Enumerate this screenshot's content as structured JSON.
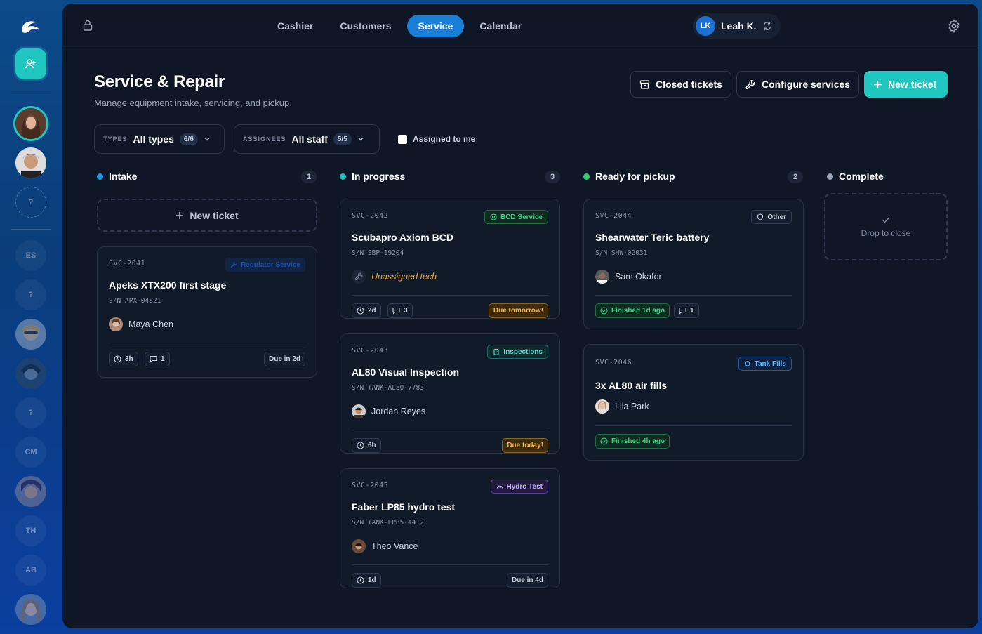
{
  "nav": {
    "tabs": [
      {
        "label": "Cashier"
      },
      {
        "label": "Customers"
      },
      {
        "label": "Service"
      },
      {
        "label": "Calendar"
      }
    ],
    "user": {
      "initials": "LK",
      "name": "Leah K."
    }
  },
  "rail": {
    "initials": [
      "?",
      "ES",
      "?",
      "?",
      "CM",
      "TH",
      "AB"
    ]
  },
  "page": {
    "title": "Service & Repair",
    "subtitle": "Manage equipment intake, servicing, and pickup."
  },
  "actions": {
    "closed": "Closed tickets",
    "configure": "Configure services",
    "new": "New ticket"
  },
  "filters": {
    "types": {
      "key": "TYPES",
      "value": "All types",
      "count": "6/6"
    },
    "assignees": {
      "key": "ASSIGNEES",
      "value": "All staff",
      "count": "5/5"
    },
    "assigned_to_me": "Assigned to me"
  },
  "columns": {
    "intake": {
      "title": "Intake",
      "count": "1",
      "add_label": "New ticket"
    },
    "progress": {
      "title": "In progress",
      "count": "3"
    },
    "ready": {
      "title": "Ready for pickup",
      "count": "2"
    },
    "complete": {
      "title": "Complete",
      "drop_label": "Drop to close"
    }
  },
  "tickets": {
    "t2041": {
      "code": "SVC-2041",
      "tag": "Regulator Service",
      "title": "Apeks XTX200 first stage",
      "sn": "S/N APX-04821",
      "tech": "Maya Chen",
      "time": "3h",
      "comments": "1",
      "due": "Due in 2d"
    },
    "t2042": {
      "code": "SVC-2042",
      "tag": "BCD Service",
      "title": "Scubapro Axiom BCD",
      "sn": "S/N SBP-19204",
      "tech": "Unassigned tech",
      "time": "2d",
      "comments": "3",
      "due": "Due tomorrow!"
    },
    "t2043": {
      "code": "SVC-2043",
      "tag": "Inspections",
      "title": "AL80 Visual Inspection",
      "sn": "S/N TANK-AL80-7783",
      "tech": "Jordan Reyes",
      "time": "6h",
      "due": "Due today!"
    },
    "t2045": {
      "code": "SVC-2045",
      "tag": "Hydro Test",
      "title": "Faber LP85 hydro test",
      "sn": "S/N TANK-LP85-4412",
      "tech": "Theo Vance",
      "time": "1d",
      "due": "Due in 4d"
    },
    "t2044": {
      "code": "SVC-2044",
      "tag": "Other",
      "title": "Shearwater Teric battery",
      "sn": "S/N SHW-02031",
      "tech": "Sam Okafor",
      "finished": "Finished 1d ago",
      "comments": "1"
    },
    "t2046": {
      "code": "SVC-2046",
      "tag": "Tank Fills",
      "title": "3x AL80 air fills",
      "tech": "Lila Park",
      "finished": "Finished 4h ago"
    }
  }
}
